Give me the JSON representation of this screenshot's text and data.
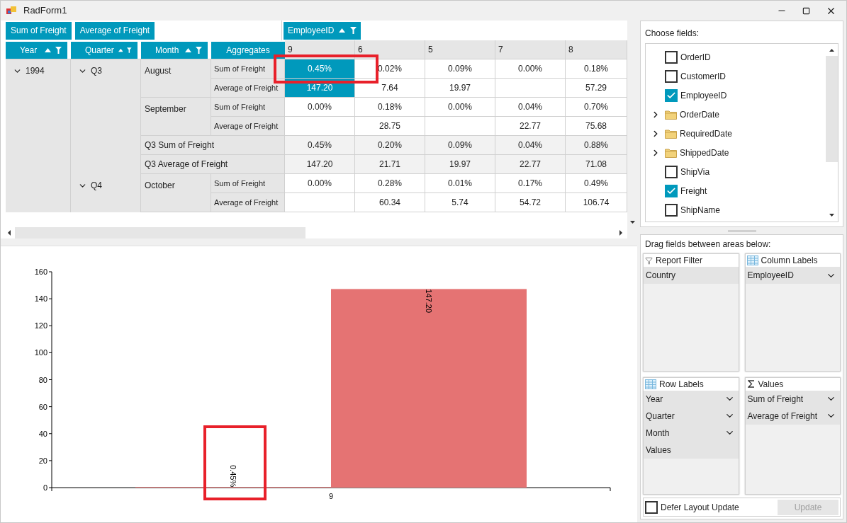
{
  "window": {
    "title": "RadForm1"
  },
  "pivot": {
    "value_fields": [
      "Sum of Freight",
      "Average of Freight"
    ],
    "column_field": "EmployeeID",
    "row_fields": [
      "Year",
      "Quarter",
      "Month"
    ],
    "aggregates_label": "Aggregates",
    "columns": [
      "9",
      "6",
      "5",
      "7",
      "8"
    ],
    "years": [
      {
        "label": "1994",
        "expanded": true,
        "quarters": [
          {
            "label": "Q3",
            "expanded": true,
            "months": [
              {
                "label": "August",
                "rows": [
                  {
                    "aggregate": "Sum of Freight",
                    "cells": [
                      {
                        "value": "0.45%",
                        "selected": true
                      },
                      {
                        "value": "0.02%",
                        "selected": false
                      },
                      {
                        "value": "0.09%",
                        "selected": false
                      },
                      {
                        "value": "0.00%",
                        "selected": false
                      },
                      {
                        "value": "0.18%",
                        "selected": false
                      }
                    ]
                  },
                  {
                    "aggregate": "Average of Freight",
                    "cells": [
                      {
                        "value": "147.20",
                        "selected": true
                      },
                      {
                        "value": "7.64",
                        "selected": false
                      },
                      {
                        "value": "19.97",
                        "selected": false
                      },
                      null,
                      {
                        "value": "57.29",
                        "selected": false
                      }
                    ]
                  }
                ]
              },
              {
                "label": "September",
                "rows": [
                  {
                    "aggregate": "Sum of Freight",
                    "cells": [
                      {
                        "value": "0.00%",
                        "selected": false
                      },
                      {
                        "value": "0.18%",
                        "selected": false
                      },
                      {
                        "value": "0.00%",
                        "selected": false
                      },
                      {
                        "value": "0.04%",
                        "selected": false
                      },
                      {
                        "value": "0.70%",
                        "selected": false
                      }
                    ]
                  },
                  {
                    "aggregate": "Average of Freight",
                    "cells": [
                      null,
                      {
                        "value": "28.75",
                        "selected": false
                      },
                      null,
                      {
                        "value": "22.77",
                        "selected": false
                      },
                      {
                        "value": "75.68",
                        "selected": false
                      }
                    ]
                  }
                ]
              }
            ],
            "totals": [
              {
                "label": "Q3 Sum of Freight",
                "cells": [
                  {
                    "value": "0.45%",
                    "selected": false
                  },
                  {
                    "value": "0.20%",
                    "selected": false
                  },
                  {
                    "value": "0.09%",
                    "selected": false
                  },
                  {
                    "value": "0.04%",
                    "selected": false
                  },
                  {
                    "value": "0.88%",
                    "selected": false
                  }
                ]
              },
              {
                "label": "Q3 Average of Freight",
                "cells": [
                  {
                    "value": "147.20",
                    "selected": false
                  },
                  {
                    "value": "21.71",
                    "selected": false
                  },
                  {
                    "value": "19.97",
                    "selected": false
                  },
                  {
                    "value": "22.77",
                    "selected": false
                  },
                  {
                    "value": "71.08",
                    "selected": false
                  }
                ]
              }
            ]
          },
          {
            "label": "Q4",
            "expanded": true,
            "months": [
              {
                "label": "October",
                "rows": [
                  {
                    "aggregate": "Sum of Freight",
                    "cells": [
                      {
                        "value": "0.00%",
                        "selected": false
                      },
                      {
                        "value": "0.28%",
                        "selected": false
                      },
                      {
                        "value": "0.01%",
                        "selected": false
                      },
                      {
                        "value": "0.17%",
                        "selected": false
                      },
                      {
                        "value": "0.49%",
                        "selected": false
                      }
                    ]
                  },
                  {
                    "aggregate": "Average of Freight",
                    "cells": [
                      null,
                      {
                        "value": "60.34",
                        "selected": false
                      },
                      {
                        "value": "5.74",
                        "selected": false
                      },
                      {
                        "value": "54.72",
                        "selected": false
                      },
                      {
                        "value": "106.74",
                        "selected": false
                      }
                    ]
                  }
                ]
              }
            ]
          }
        ]
      }
    ]
  },
  "chart": {
    "chart_data": {
      "type": "bar",
      "categories": [
        "9"
      ],
      "series": [
        {
          "color": "#e57373",
          "values": [
            0.45
          ]
        },
        {
          "color": "#e57373",
          "values": [
            147.2
          ]
        }
      ],
      "ylim": [
        0,
        160
      ],
      "yticks": [
        0,
        20,
        40,
        60,
        80,
        100,
        120,
        140,
        160
      ],
      "value_labels": [
        [
          "0.45%"
        ],
        [
          "147.20"
        ]
      ]
    }
  },
  "field_list": {
    "title": "Choose fields:",
    "fields": [
      {
        "label": "OrderID",
        "kind": "checkbox",
        "checked": false
      },
      {
        "label": "CustomerID",
        "kind": "checkbox",
        "checked": false
      },
      {
        "label": "EmployeeID",
        "kind": "checkbox",
        "checked": true
      },
      {
        "label": "OrderDate",
        "kind": "folder",
        "expanded": false
      },
      {
        "label": "RequiredDate",
        "kind": "folder",
        "expanded": false
      },
      {
        "label": "ShippedDate",
        "kind": "folder",
        "expanded": false
      },
      {
        "label": "ShipVia",
        "kind": "checkbox",
        "checked": false
      },
      {
        "label": "Freight",
        "kind": "checkbox",
        "checked": true
      },
      {
        "label": "ShipName",
        "kind": "checkbox",
        "checked": false
      }
    ]
  },
  "areas": {
    "title": "Drag fields between areas below:",
    "zones": [
      {
        "kind": "filter",
        "title": "Report Filter",
        "fields": [
          {
            "label": "Country",
            "dropdown": false
          }
        ]
      },
      {
        "kind": "columns",
        "title": "Column Labels",
        "fields": [
          {
            "label": "EmployeeID",
            "dropdown": true
          }
        ]
      },
      {
        "kind": "rows",
        "title": "Row Labels",
        "fields": [
          {
            "label": "Year",
            "dropdown": true
          },
          {
            "label": "Quarter",
            "dropdown": true
          },
          {
            "label": "Month",
            "dropdown": true
          },
          {
            "label": "Values",
            "dropdown": false
          }
        ]
      },
      {
        "kind": "values",
        "title": "Values",
        "fields": [
          {
            "label": "Sum of Freight",
            "dropdown": true
          },
          {
            "label": "Average of Freight",
            "dropdown": true
          }
        ]
      }
    ]
  },
  "defer_layout_update": {
    "label": "Defer Layout Update",
    "checked": false
  },
  "update_button": {
    "label": "Update",
    "disabled": true
  }
}
